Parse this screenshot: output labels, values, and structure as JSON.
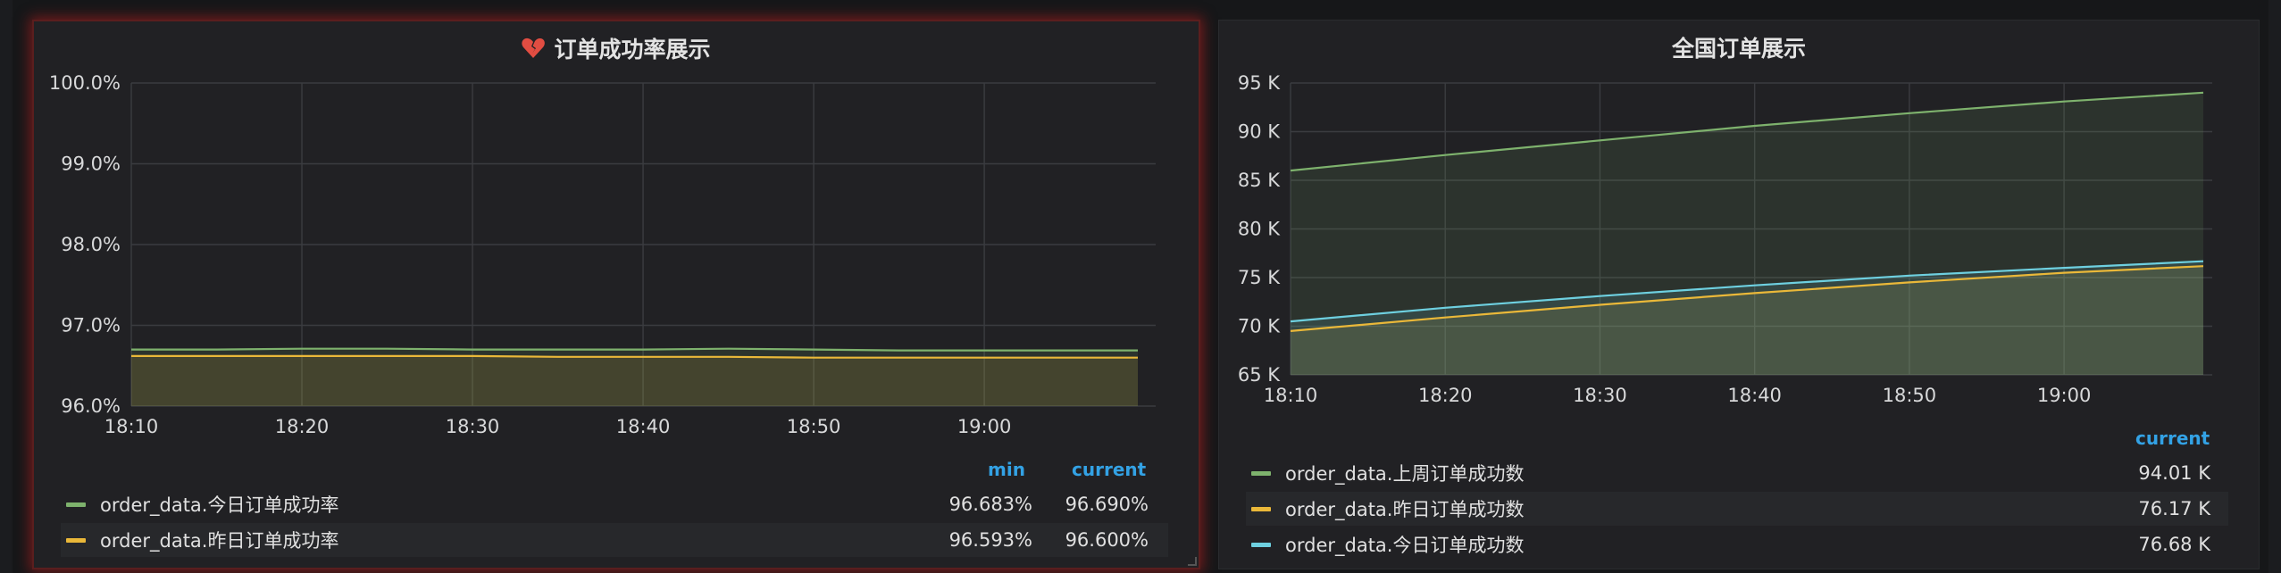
{
  "panels": {
    "left": {
      "title": "订单成功率展示",
      "icon": "broken-heart-icon",
      "legend_headers": {
        "min": "min",
        "current": "current"
      },
      "legend": [
        {
          "name": "order_data.今日订单成功率",
          "min": "96.683%",
          "current": "96.690%",
          "color": "#7eb26d"
        },
        {
          "name": "order_data.昨日订单成功率",
          "min": "96.593%",
          "current": "96.600%",
          "color": "#eab839"
        }
      ]
    },
    "right": {
      "title": "全国订单展示",
      "legend_headers": {
        "current": "current"
      },
      "legend": [
        {
          "name": "order_data.上周订单成功数",
          "current": "94.01 K",
          "color": "#7eb26d"
        },
        {
          "name": "order_data.昨日订单成功数",
          "current": "76.17 K",
          "color": "#eab839"
        },
        {
          "name": "order_data.今日订单成功数",
          "current": "76.68 K",
          "color": "#6ed0e0"
        }
      ]
    }
  },
  "chart_data": [
    {
      "type": "area",
      "title": "订单成功率展示",
      "x_ticks": [
        "18:10",
        "18:20",
        "18:30",
        "18:40",
        "18:50",
        "19:00"
      ],
      "y_ticks": [
        "96.0%",
        "97.0%",
        "98.0%",
        "99.0%",
        "100.0%"
      ],
      "ylim": [
        96.0,
        100.0
      ],
      "x_minutes_range": [
        10,
        69
      ],
      "grid": true,
      "legend_placement": "bottom",
      "series": [
        {
          "name": "order_data.今日订单成功率",
          "color": "#7eb26d",
          "x_minutes": [
            10,
            15,
            20,
            25,
            30,
            35,
            40,
            45,
            50,
            55,
            60,
            65,
            69
          ],
          "values": [
            96.7,
            96.7,
            96.71,
            96.71,
            96.7,
            96.7,
            96.7,
            96.71,
            96.7,
            96.69,
            96.69,
            96.69,
            96.69
          ]
        },
        {
          "name": "order_data.昨日订单成功率",
          "color": "#eab839",
          "x_minutes": [
            10,
            15,
            20,
            25,
            30,
            35,
            40,
            45,
            50,
            55,
            60,
            65,
            69
          ],
          "values": [
            96.62,
            96.62,
            96.62,
            96.62,
            96.62,
            96.61,
            96.61,
            96.61,
            96.6,
            96.6,
            96.6,
            96.6,
            96.6
          ]
        }
      ]
    },
    {
      "type": "area",
      "title": "全国订单展示",
      "x_ticks": [
        "18:10",
        "18:20",
        "18:30",
        "18:40",
        "18:50",
        "19:00"
      ],
      "y_ticks": [
        "65 K",
        "70 K",
        "75 K",
        "80 K",
        "85 K",
        "90 K",
        "95 K"
      ],
      "ylim": [
        65,
        95
      ],
      "y_unit": "K",
      "x_minutes_range": [
        10,
        69
      ],
      "grid": true,
      "legend_placement": "bottom",
      "series": [
        {
          "name": "order_data.上周订单成功数",
          "color": "#7eb26d",
          "x_minutes": [
            10,
            20,
            30,
            40,
            50,
            60,
            69
          ],
          "values": [
            86.0,
            87.6,
            89.1,
            90.6,
            91.9,
            93.1,
            94.01
          ]
        },
        {
          "name": "order_data.昨日订单成功数",
          "color": "#eab839",
          "x_minutes": [
            10,
            20,
            30,
            40,
            50,
            60,
            69
          ],
          "values": [
            69.5,
            70.9,
            72.2,
            73.4,
            74.5,
            75.5,
            76.17
          ]
        },
        {
          "name": "order_data.今日订单成功数",
          "color": "#6ed0e0",
          "x_minutes": [
            10,
            20,
            30,
            40,
            50,
            60,
            69
          ],
          "values": [
            70.5,
            71.9,
            73.1,
            74.2,
            75.2,
            76.0,
            76.68
          ]
        }
      ]
    }
  ]
}
